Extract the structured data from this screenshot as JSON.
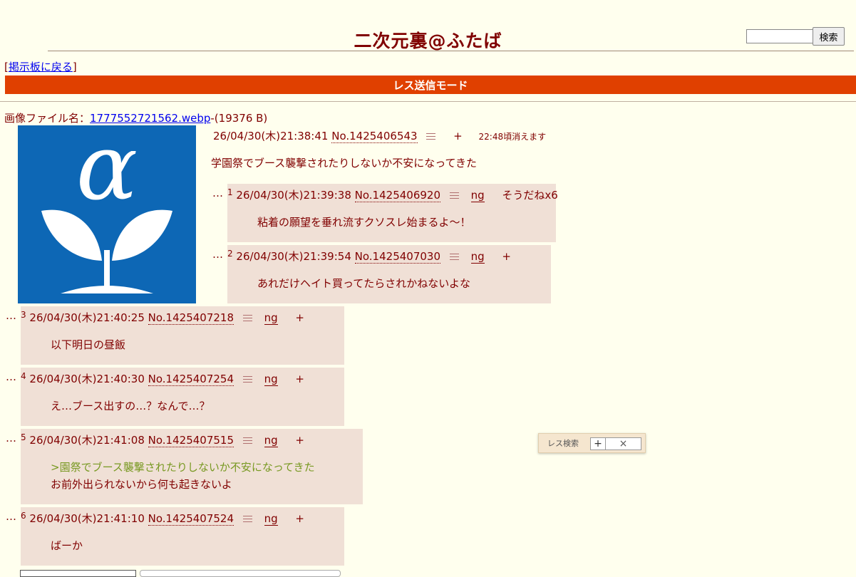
{
  "header": {
    "title": "二次元裏@ふたば",
    "search_value": "",
    "search_button": "検索"
  },
  "nav": {
    "bracket_open": "[",
    "back_link": "掲示板に戻る",
    "bracket_close": "]"
  },
  "mode_bar": "レス送信モード",
  "op": {
    "file_label": "画像ファイル名：",
    "file_name": "1777552721562.webp",
    "file_size": "-(19376 B)",
    "date": "26/04/30(木)21:38:41",
    "no": "No.1425406543",
    "plus": "+",
    "expire": "22:48頃消えます",
    "body": "学園祭でブース襲撃されたりしないか不安になってきた"
  },
  "replies": [
    {
      "dots": "…",
      "num": "1",
      "date": "26/04/30(木)21:39:38",
      "no": "No.1425406920",
      "ng": "ng",
      "extra": "そうだねx6",
      "lines": [
        {
          "text": "粘着の願望を垂れ流すクソスレ始まるよ～！",
          "quote": false
        }
      ]
    },
    {
      "dots": "…",
      "num": "2",
      "date": "26/04/30(木)21:39:54",
      "no": "No.1425407030",
      "ng": "ng",
      "extra": "+",
      "lines": [
        {
          "text": "あれだけヘイト買ってたらされかねないよな",
          "quote": false
        }
      ]
    },
    {
      "dots": "…",
      "num": "3",
      "date": "26/04/30(木)21:40:25",
      "no": "No.1425407218",
      "ng": "ng",
      "extra": "+",
      "lines": [
        {
          "text": "以下明日の昼飯",
          "quote": false
        }
      ]
    },
    {
      "dots": "…",
      "num": "4",
      "date": "26/04/30(木)21:40:30",
      "no": "No.1425407254",
      "ng": "ng",
      "extra": "+",
      "lines": [
        {
          "text": "え…ブース出すの…？なんで…？",
          "quote": false
        }
      ]
    },
    {
      "dots": "…",
      "num": "5",
      "date": "26/04/30(木)21:41:08",
      "no": "No.1425407515",
      "ng": "ng",
      "extra": "+",
      "lines": [
        {
          "text": ">園祭でブース襲撃されたりしないか不安になってきた",
          "quote": true
        },
        {
          "text": "お前外出られないから何も起きないよ",
          "quote": false
        }
      ]
    },
    {
      "dots": "…",
      "num": "6",
      "date": "26/04/30(木)21:41:10",
      "no": "No.1425407524",
      "ng": "ng",
      "extra": "+",
      "lines": [
        {
          "text": "ばーか",
          "quote": false
        }
      ]
    }
  ],
  "float_panel": {
    "label": "レス検索",
    "plus": "+",
    "close": "×"
  },
  "colors": {
    "background": "#ffffee",
    "text": "#800000",
    "mode_bar": "#e04000",
    "reply_bg": "#f0e0d6",
    "quote": "#789922",
    "thumb_bg": "#0d67b5"
  },
  "icons": {
    "thumbnail": "alpha-sprout-logo",
    "menu": "list-menu-icon"
  }
}
